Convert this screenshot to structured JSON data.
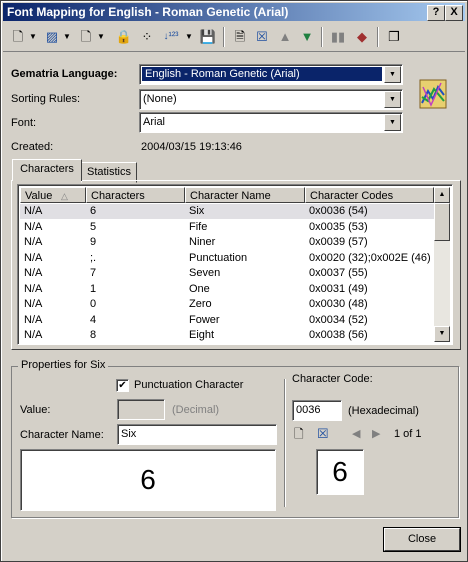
{
  "window": {
    "title": "Font Mapping for English - Roman Genetic (Arial)",
    "help_btn": "?",
    "close_btn": "X"
  },
  "toolbar": {
    "icons": [
      "new-doc-icon",
      "dropdown-arrow",
      "edit-doc-icon",
      "dropdown-arrow",
      "delete-doc-icon",
      "dropdown-arrow",
      "lock-icon",
      "shuffle-icon",
      "numbering-icon",
      "dropdown-arrow",
      "save-icon",
      "page-icon",
      "delete-icon",
      "up-arrow-icon",
      "down-arrow-icon",
      "bar-chart-icon",
      "cube-icon",
      "copy-windows-icon"
    ]
  },
  "form": {
    "gematria_label": "Gematria Language:",
    "gematria_value": "English - Roman Genetic (Arial)",
    "sorting_label": "Sorting Rules:",
    "sorting_value": "(None)",
    "font_label": "Font:",
    "font_value": "Arial",
    "created_label": "Created:",
    "created_value": "2004/03/15 19:13:46"
  },
  "tabs": [
    {
      "label": "Characters"
    },
    {
      "label": "Statistics"
    }
  ],
  "table": {
    "columns": [
      "Value",
      "Characters",
      "Character Name",
      "Character Codes"
    ],
    "rows": [
      {
        "value": "N/A",
        "chars": "6",
        "name": "Six",
        "codes": "0x0036 (54)"
      },
      {
        "value": "N/A",
        "chars": "5",
        "name": "Fife",
        "codes": "0x0035 (53)"
      },
      {
        "value": "N/A",
        "chars": "9",
        "name": "Niner",
        "codes": "0x0039 (57)"
      },
      {
        "value": "N/A",
        "chars": " ;.",
        "name": "Punctuation",
        "codes": "0x0020 (32);0x002E (46)"
      },
      {
        "value": "N/A",
        "chars": "7",
        "name": "Seven",
        "codes": "0x0037 (55)"
      },
      {
        "value": "N/A",
        "chars": "1",
        "name": "One",
        "codes": "0x0031 (49)"
      },
      {
        "value": "N/A",
        "chars": "0",
        "name": "Zero",
        "codes": "0x0030 (48)"
      },
      {
        "value": "N/A",
        "chars": "4",
        "name": "Fower",
        "codes": "0x0034 (52)"
      },
      {
        "value": "N/A",
        "chars": "8",
        "name": "Eight",
        "codes": "0x0038 (56)"
      }
    ]
  },
  "properties": {
    "group_title": "Properties for Six",
    "punct_label": "Punctuation Character",
    "punct_checked": "✔",
    "value_label": "Value:",
    "value_value": "",
    "decimal_hint": "(Decimal)",
    "name_label": "Character Name:",
    "name_value": "Six",
    "preview_text": "6",
    "code_label": "Character Code:",
    "code_value": "0036",
    "hex_hint": "(Hexadecimal)",
    "pager": "1 of 1",
    "small_preview": "6"
  },
  "close_button": "Close"
}
